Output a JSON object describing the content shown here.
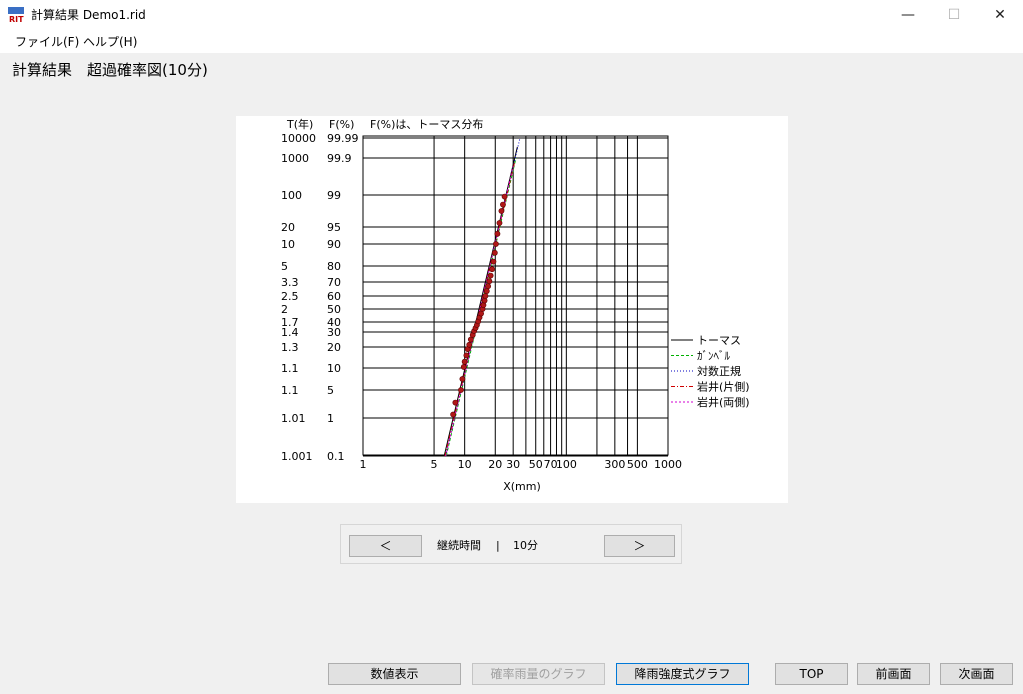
{
  "window": {
    "title": "計算結果 Demo1.rid",
    "logo_text": "RIT",
    "controls": {
      "minimize": "—",
      "maximize": "☐",
      "close": "✕"
    }
  },
  "menu": {
    "items": [
      "ファイル(F)",
      "ヘルプ(H)"
    ]
  },
  "page": {
    "heading": "計算結果　超過確率図(10分)"
  },
  "chart": {
    "header": {
      "t_label": "T(年)",
      "f_label": "F(%)",
      "note": "F(%)は、トーマス分布"
    },
    "xlabel": "X(mm)",
    "legend": [
      {
        "name": "トーマス",
        "color": "#000000",
        "dash": ""
      },
      {
        "name": "ｶﾞﾝﾍﾞﾙ",
        "color": "#00b000",
        "dash": "3,2"
      },
      {
        "name": "対数正規",
        "color": "#0000c0",
        "dash": "1,2"
      },
      {
        "name": "岩井(片側)",
        "color": "#d00000",
        "dash": "4,2,1,2"
      },
      {
        "name": "岩井(両側)",
        "color": "#d000d0",
        "dash": "2,2"
      }
    ]
  },
  "chart_data": {
    "type": "scatter",
    "xscale": "log",
    "xlim": [
      1,
      1000
    ],
    "xticks": [
      {
        "v": 1,
        "label": "1"
      },
      {
        "v": 5,
        "label": "5"
      },
      {
        "v": 10,
        "label": "10"
      },
      {
        "v": 20,
        "label": "20"
      },
      {
        "v": 30,
        "label": "30"
      },
      {
        "v": 50,
        "label": "50"
      },
      {
        "v": 70,
        "label": "70"
      },
      {
        "v": 100,
        "label": "100"
      },
      {
        "v": 300,
        "label": "300"
      },
      {
        "v": 500,
        "label": "500"
      },
      {
        "v": 1000,
        "label": "1000"
      }
    ],
    "xgrid": [
      1,
      5,
      10,
      20,
      30,
      40,
      50,
      60,
      70,
      80,
      90,
      100,
      200,
      300,
      400,
      500,
      1000
    ],
    "yticks": [
      {
        "f": 99.99,
        "t": "10000",
        "label": "99.99"
      },
      {
        "f": 99.9,
        "t": "1000",
        "label": "99.9"
      },
      {
        "f": 99,
        "t": "100",
        "label": "99"
      },
      {
        "f": 95,
        "t": "20",
        "label": "95"
      },
      {
        "f": 90,
        "t": "10",
        "label": "90"
      },
      {
        "f": 80,
        "t": "5",
        "label": "80"
      },
      {
        "f": 70,
        "t": "3.3",
        "label": "70"
      },
      {
        "f": 60,
        "t": "2.5",
        "label": "60"
      },
      {
        "f": 50,
        "t": "2",
        "label": "50"
      },
      {
        "f": 40,
        "t": "1.7",
        "label": "40"
      },
      {
        "f": 30,
        "t": "1.4",
        "label": "30"
      },
      {
        "f": 20,
        "t": "1.3",
        "label": "20"
      },
      {
        "f": 10,
        "t": "1.1",
        "label": "10"
      },
      {
        "f": 5,
        "t": "1.1",
        "label": "5"
      },
      {
        "f": 1,
        "t": "1.01",
        "label": "1"
      },
      {
        "f": 0.1,
        "t": "1.001",
        "label": "0.1"
      }
    ],
    "points": [
      [
        7.7,
        1.5
      ],
      [
        8.1,
        3.2
      ],
      [
        9.2,
        5.0
      ],
      [
        9.5,
        7.5
      ],
      [
        9.8,
        10.5
      ],
      [
        10.0,
        13.0
      ],
      [
        10.4,
        16.0
      ],
      [
        10.7,
        19.0
      ],
      [
        11.1,
        21.5
      ],
      [
        11.5,
        25.0
      ],
      [
        12.0,
        28.0
      ],
      [
        12.4,
        31.0
      ],
      [
        12.8,
        34.0
      ],
      [
        13.2,
        37.0
      ],
      [
        13.6,
        40.5
      ],
      [
        14.0,
        43.5
      ],
      [
        14.5,
        46.5
      ],
      [
        15.0,
        50.0
      ],
      [
        15.3,
        53.0
      ],
      [
        15.7,
        56.5
      ],
      [
        16.0,
        60.0
      ],
      [
        16.5,
        63.5
      ],
      [
        17.0,
        67.0
      ],
      [
        17.5,
        70.5
      ],
      [
        18.0,
        74.0
      ],
      [
        18.6,
        78.0
      ],
      [
        19.2,
        82.0
      ],
      [
        19.8,
        86.0
      ],
      [
        20.3,
        90.0
      ],
      [
        21.0,
        93.0
      ],
      [
        22.0,
        95.5
      ],
      [
        23.0,
        97.0
      ],
      [
        23.8,
        97.8
      ],
      [
        24.7,
        98.8
      ]
    ],
    "fits": [
      {
        "name": "トーマス",
        "x": [
          6.3,
          33.0
        ],
        "f": [
          0.11,
          99.95
        ]
      },
      {
        "name": "ｶﾞﾝﾍﾞﾙ",
        "x": [
          6.6,
          32.0
        ],
        "f": [
          0.11,
          99.9
        ]
      },
      {
        "name": "対数正規",
        "x": [
          6.5,
          35.0
        ],
        "f": [
          0.1,
          99.99
        ]
      },
      {
        "name": "岩井(片側)",
        "x": [
          6.4,
          31.0
        ],
        "f": [
          0.1,
          99.8
        ]
      },
      {
        "name": "岩井(両側)",
        "x": [
          6.5,
          30.0
        ],
        "f": [
          0.1,
          99.7
        ]
      }
    ]
  },
  "nav": {
    "prev": "＜",
    "label": "継続時間",
    "separator": "|",
    "value": "10分",
    "next": "＞"
  },
  "footer": {
    "numeric": "数値表示",
    "prob_graph": "確率雨量のグラフ",
    "intensity_graph": "降雨強度式グラフ",
    "top": "TOP",
    "prev_screen": "前画面",
    "next_screen": "次画面"
  }
}
